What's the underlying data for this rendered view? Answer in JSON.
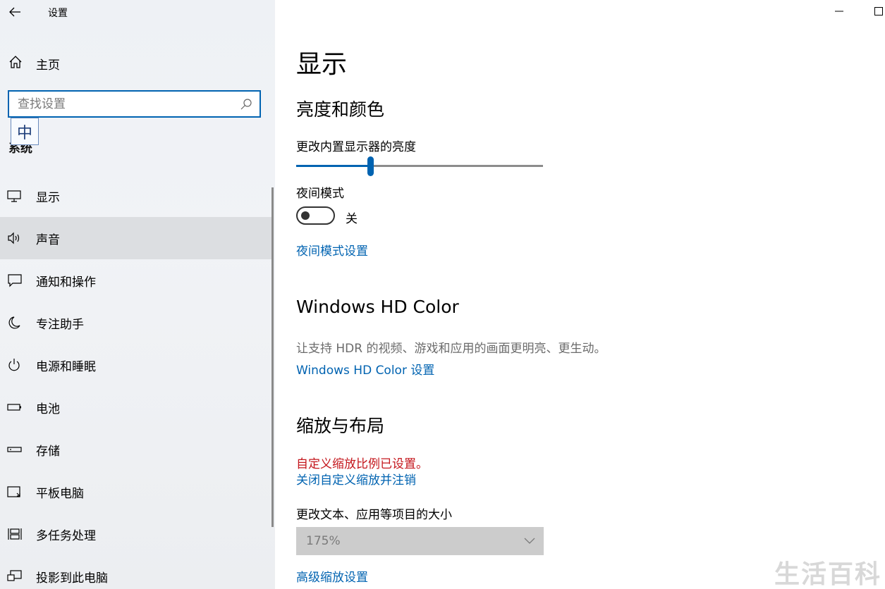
{
  "window": {
    "title": "设置"
  },
  "sidebar": {
    "home_label": "主页",
    "search_placeholder": "查找设置",
    "ime_indicator": "中",
    "section_title": "系统",
    "items": [
      {
        "label": "显示",
        "icon": "monitor-icon"
      },
      {
        "label": "声音",
        "icon": "speaker-icon",
        "active": true
      },
      {
        "label": "通知和操作",
        "icon": "notification-icon"
      },
      {
        "label": "专注助手",
        "icon": "moon-icon"
      },
      {
        "label": "电源和睡眠",
        "icon": "power-icon"
      },
      {
        "label": "电池",
        "icon": "battery-icon"
      },
      {
        "label": "存储",
        "icon": "storage-icon"
      },
      {
        "label": "平板电脑",
        "icon": "tablet-icon"
      },
      {
        "label": "多任务处理",
        "icon": "multitask-icon"
      },
      {
        "label": "投影到此电脑",
        "icon": "project-icon"
      }
    ]
  },
  "main": {
    "page_title": "显示",
    "brightness": {
      "heading": "亮度和颜色",
      "slider_label": "更改内置显示器的亮度",
      "slider_value_pct": 30
    },
    "night_light": {
      "label": "夜间模式",
      "state": "关",
      "settings_link": "夜间模式设置"
    },
    "hd_color": {
      "heading": "Windows HD Color",
      "description": "让支持 HDR 的视频、游戏和应用的画面更明亮、更生动。",
      "link": "Windows HD Color 设置"
    },
    "scale_layout": {
      "heading": "缩放与布局",
      "warning": "自定义缩放比例已设置。",
      "signout_link": "关闭自定义缩放并注销",
      "size_label": "更改文本、应用等项目的大小",
      "size_value": "175%",
      "advanced_link": "高级缩放设置"
    }
  },
  "watermark": "生活百科",
  "colors": {
    "accent": "#0063b1",
    "warning": "#c4161c"
  }
}
